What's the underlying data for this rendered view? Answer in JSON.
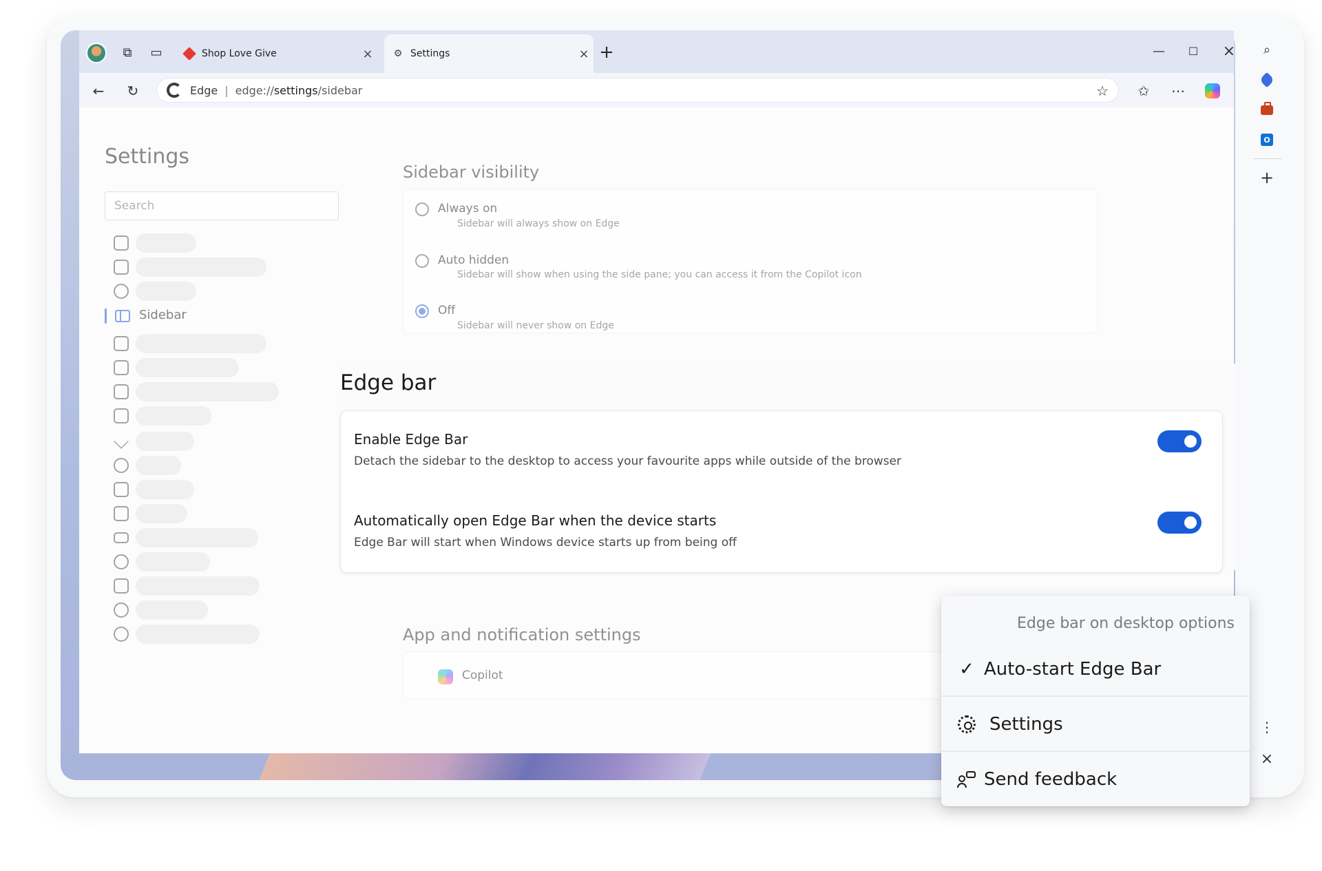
{
  "tabs": [
    {
      "label": "Shop Love Give",
      "active": false
    },
    {
      "label": "Settings",
      "active": true
    }
  ],
  "address": {
    "site": "Edge",
    "separator": "|",
    "url_prefix": "edge://",
    "url_strong": "settings",
    "url_suffix": "/sidebar"
  },
  "settings": {
    "title": "Settings",
    "search_placeholder": "Search",
    "active_nav_label": "Sidebar"
  },
  "sidebar_visibility": {
    "heading": "Sidebar visibility",
    "options": [
      {
        "label": "Always on",
        "desc": "Sidebar will always show on Edge",
        "selected": false
      },
      {
        "label": "Auto hidden",
        "desc": "Sidebar will show when using the side pane; you can access it from the Copilot icon",
        "selected": false
      },
      {
        "label": "Off",
        "desc": "Sidebar will never show on Edge",
        "selected": true
      }
    ]
  },
  "edge_bar": {
    "heading": "Edge bar",
    "settings": [
      {
        "title": "Enable Edge Bar",
        "desc": "Detach the sidebar to the desktop to access your favourite apps while outside of the browser",
        "enabled": true
      },
      {
        "title": "Automatically open Edge Bar when the device starts",
        "desc": "Edge Bar will start when Windows device starts up from being off",
        "enabled": true
      }
    ]
  },
  "app_notifications": {
    "heading": "App and notification settings",
    "apps": [
      {
        "label": "Copilot"
      }
    ]
  },
  "context_menu": {
    "header": "Edge bar on desktop options",
    "items": [
      {
        "label": "Auto-start Edge Bar",
        "icon": "checkmark-icon",
        "checked": true
      },
      {
        "label": "Settings",
        "icon": "gear-icon"
      },
      {
        "label": "Send feedback",
        "icon": "feedback-icon"
      }
    ]
  },
  "colors": {
    "accent": "#1a5dd8",
    "titlebar": "#dfe5f2",
    "page_bg": "#fcfcfd"
  }
}
